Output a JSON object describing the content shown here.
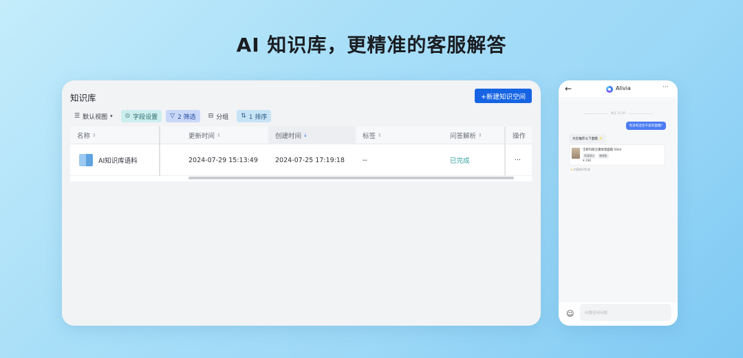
{
  "headline": "AI 知识库，更精准的客服解答",
  "knowledge_base": {
    "title": "知识库",
    "new_button": {
      "label": "+新建知识空间",
      "accent": "#1664e3"
    },
    "toolbar": [
      {
        "icon": "list-icon",
        "glyph": "☰",
        "label": "默认视图",
        "suffix": "▾",
        "style": "plain"
      },
      {
        "icon": "settings-circle-icon",
        "glyph": "⊙",
        "label": "字段设置",
        "style": "green"
      },
      {
        "icon": "filter-icon",
        "glyph": "▽",
        "label": "2 筛选",
        "style": "blue"
      },
      {
        "icon": "group-icon",
        "glyph": "⊟",
        "label": "分组",
        "style": "plain"
      },
      {
        "icon": "sort-icon",
        "glyph": "⇅",
        "label": "1 排序",
        "style": "lblue"
      }
    ],
    "columns": {
      "name": "名称",
      "updated": "更新时间",
      "created": "创建时间",
      "tags": "标签",
      "qa_parse": "问答解析",
      "actions": "操作"
    },
    "rows": [
      {
        "name": "AI知识库语料",
        "updated": "2024-07-29 15:13:49",
        "created": "2024-07-25 17:19:18",
        "tags": "--",
        "qa_parse": "已完成",
        "actions": "···"
      }
    ]
  },
  "phone": {
    "back_glyph": "←",
    "assistant_name": "Alivia",
    "more_glyph": "···",
    "timestamp": "昨天 15:20",
    "user_message": "有没有适合干皮的面霜?",
    "bot_message": "为您推荐以下面霜 ✨",
    "product": {
      "name": "全新玛丽兰黛保湿面霜 50ml",
      "tags": [
        "保湿锁水",
        "敏感肌"
      ],
      "price": "¥ 298"
    },
    "note": "内容由AI生成",
    "note_star": "★",
    "input_placeholder": "问我任何问题",
    "chat_glyph": "☺"
  },
  "colors": {
    "done": "#2fa39a",
    "accent": "#1664e3"
  }
}
